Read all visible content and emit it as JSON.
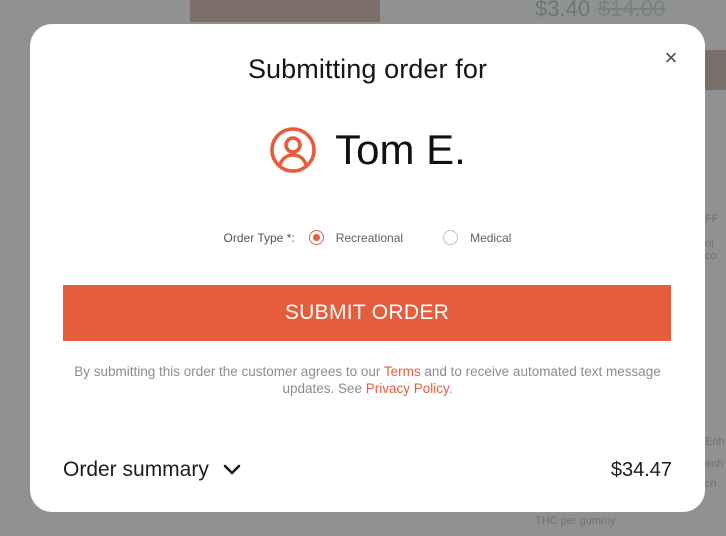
{
  "background": {
    "price_current": "$3.40",
    "price_old": "$14.00",
    "side_text_1": "FF",
    "side_text_2": "nt co",
    "side_text_3": "Enh",
    "side_text_4": "enh",
    "side_text_5": "ch",
    "side_text_6": "THC per gummy"
  },
  "modal": {
    "close_label": "×",
    "title": "Submitting order for",
    "customer_icon": "user-circle-icon",
    "customer_name": "Tom E.",
    "order_type_label": "Order Type *:",
    "order_type_options": [
      {
        "label": "Recreational",
        "selected": true
      },
      {
        "label": "Medical",
        "selected": false
      }
    ],
    "submit_label": "SUBMIT ORDER",
    "disclaimer_pre": "By submitting this order the customer agrees to our ",
    "terms_link": "Terms",
    "disclaimer_mid": " and to receive automated text message updates. See ",
    "privacy_link": "Privacy Policy",
    "disclaimer_post": ".",
    "summary_label": "Order summary",
    "summary_icon": "chevron-down-icon",
    "total": "$34.47"
  },
  "colors": {
    "accent": "#e55d3c",
    "overlay": "#909191"
  }
}
